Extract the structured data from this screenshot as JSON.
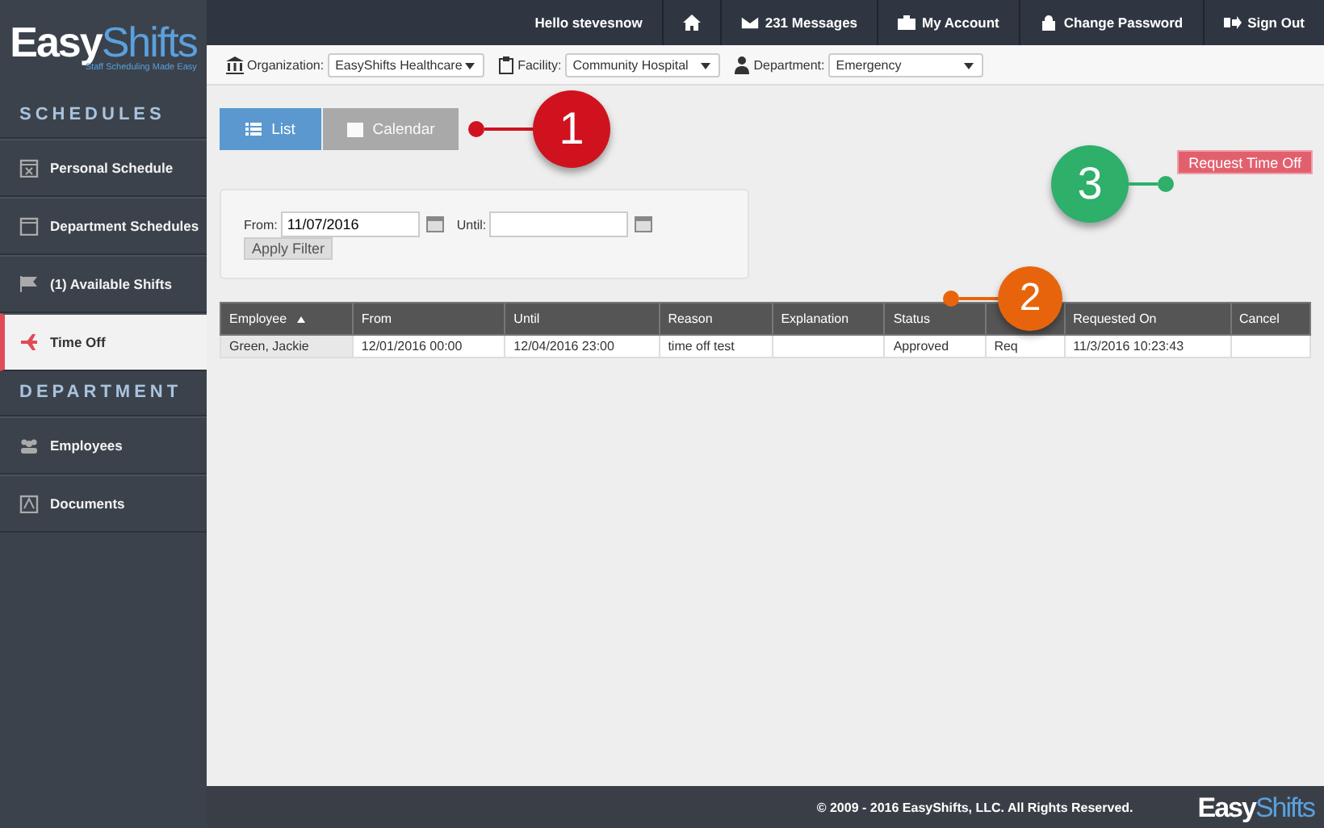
{
  "logo": {
    "word1": "Easy",
    "word2": "Shifts",
    "tagline": "Staff Scheduling Made Easy"
  },
  "topbar": {
    "greeting": "Hello stevesnow",
    "links": [
      {
        "kind": "icon"
      },
      {
        "kind": "text",
        "label": "231 Messages"
      },
      {
        "kind": "text",
        "label": "My Account"
      },
      {
        "kind": "text",
        "label": "Change Password"
      },
      {
        "kind": "text",
        "label": "Sign Out"
      }
    ]
  },
  "filters": [
    {
      "label": "Organization:",
      "value": "EasyShifts Healthcare"
    },
    {
      "label": "Facility:",
      "value": "Community Hospital"
    },
    {
      "label": "Department:",
      "value": "Emergency"
    }
  ],
  "sidebar": {
    "sections": [
      {
        "title": "SCHEDULES",
        "items": [
          {
            "label": "Personal Schedule",
            "selected": false
          },
          {
            "label": "Department Schedules",
            "selected": false
          },
          {
            "label": "(1) Available Shifts",
            "selected": false
          },
          {
            "label": "Time Off",
            "selected": true
          }
        ]
      },
      {
        "title": "DEPARTMENT",
        "items": [
          {
            "label": "Employees",
            "selected": false
          },
          {
            "label": "Documents",
            "selected": false
          }
        ]
      }
    ]
  },
  "view_tabs": [
    {
      "label": "List",
      "selected": true
    },
    {
      "label": "Calendar",
      "selected": false
    }
  ],
  "request_button": "Request Time Off",
  "date_filter": {
    "from_label": "From:",
    "from_value": "11/07/2016",
    "until_label": "Until:",
    "apply": "Apply Filter"
  },
  "table": {
    "columns": [
      "Employee",
      "From",
      "Until",
      "Reason",
      "Explanation",
      "Status",
      "",
      "Requested On",
      "Cancel"
    ],
    "rows": [
      [
        "Green, Jackie",
        "12/01/2016 00:00",
        "12/04/2016 23:00",
        "time off test",
        "",
        "Approved",
        "Req",
        "11/3/2016 10:23:43",
        ""
      ]
    ]
  },
  "callouts": [
    {
      "number": "1",
      "color": "#d0121f"
    },
    {
      "number": "2",
      "color": "#e8640c"
    },
    {
      "number": "3",
      "color": "#2eaf6a"
    }
  ],
  "footer": "© 2009 - 2016 EasyShifts, LLC. All Rights Reserved.",
  "footer_logo": {
    "word1": "Easy",
    "word2": "Shifts"
  }
}
